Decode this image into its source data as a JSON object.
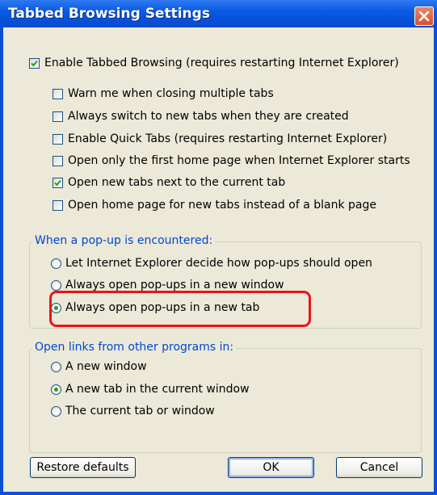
{
  "window": {
    "title": "Tabbed Browsing Settings"
  },
  "checkboxes": [
    {
      "label": "Enable Tabbed Browsing (requires restarting Internet Explorer)",
      "checked": true
    },
    {
      "label": "Warn me when closing multiple tabs",
      "checked": false
    },
    {
      "label": "Always switch to new tabs when they are created",
      "checked": false
    },
    {
      "label": "Enable Quick Tabs (requires restarting Internet Explorer)",
      "checked": false
    },
    {
      "label": "Open only the first home page when Internet Explorer starts",
      "checked": false
    },
    {
      "label": "Open new tabs next to the current tab",
      "checked": true
    },
    {
      "label": "Open home page for new tabs instead of a blank page",
      "checked": false
    }
  ],
  "popup_group": {
    "legend": "When a pop-up is encountered:",
    "options": [
      {
        "label": "Let Internet Explorer decide how pop-ups should open",
        "selected": false
      },
      {
        "label": "Always open pop-ups in a new window",
        "selected": false
      },
      {
        "label": "Always open pop-ups in a new tab",
        "selected": true
      }
    ]
  },
  "links_group": {
    "legend": "Open links from other programs in:",
    "options": [
      {
        "label": "A new window",
        "selected": false
      },
      {
        "label": "A new tab in the current window",
        "selected": true
      },
      {
        "label": "The current tab or window",
        "selected": false
      }
    ]
  },
  "buttons": {
    "restore": "Restore defaults",
    "ok": "OK",
    "cancel": "Cancel"
  },
  "colors": {
    "title_bar": "#0b5ae3",
    "client": "#ece9d8",
    "legend": "#0046d5",
    "highlight": "#e8141c",
    "radio_dot": "#21a121",
    "checkmark": "#21a121"
  }
}
